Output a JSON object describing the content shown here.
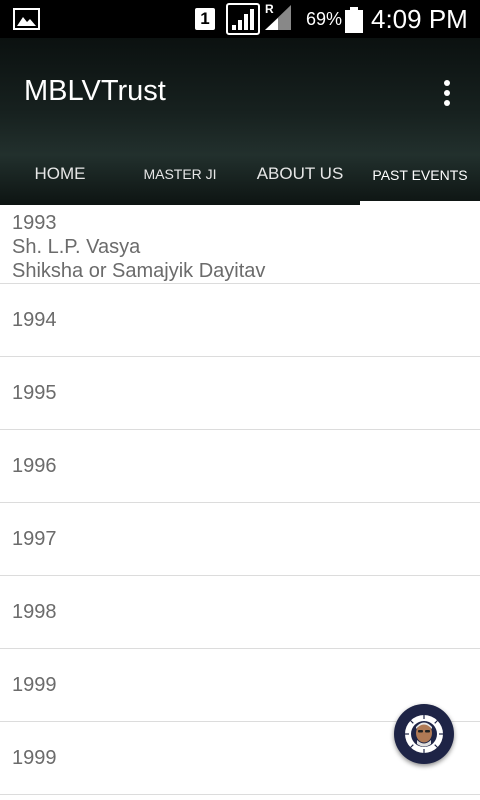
{
  "status_bar": {
    "sim_label": "1",
    "roaming_label": "R",
    "battery_percent": "69%",
    "time": "4:09 PM"
  },
  "app_bar": {
    "title": "MBLVTrust"
  },
  "tabs": [
    {
      "label": "HOME",
      "active": false
    },
    {
      "label": "MASTER JI",
      "active": false
    },
    {
      "label": "ABOUT US",
      "active": false
    },
    {
      "label": "PAST EVENTS",
      "active": true
    }
  ],
  "events": [
    {
      "year": "1993",
      "line1": "Sh. L.P. Vasya",
      "line2": "Shiksha or Samajyik Dayitav"
    },
    {
      "year": "1994"
    },
    {
      "year": "1995"
    },
    {
      "year": "1996"
    },
    {
      "year": "1997"
    },
    {
      "year": "1998"
    },
    {
      "year": "1999"
    },
    {
      "year": "1999"
    }
  ],
  "fab": {
    "icon": "profile-avatar-icon"
  }
}
